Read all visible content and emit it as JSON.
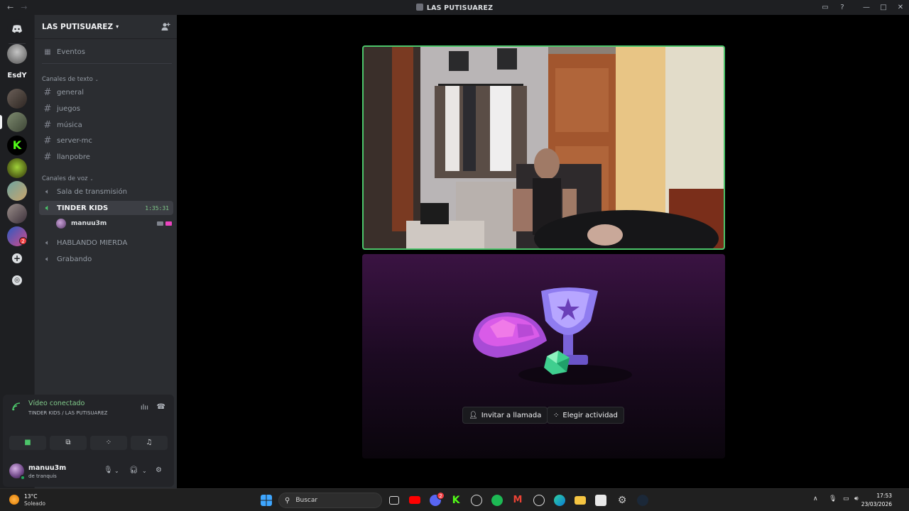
{
  "window": {
    "title": "LAS PUTISUAREZ",
    "back": "←",
    "forward": "→"
  },
  "rail": {
    "folder_label": "EsdY",
    "badge_count": "2"
  },
  "guild": {
    "name": "LAS PUTISUAREZ",
    "events": "Eventos",
    "text_category": "Canales de texto",
    "text_channels": [
      "general",
      "juegos",
      "música",
      "server-mc",
      "llanpobre"
    ],
    "voice_category": "Canales de voz",
    "voice_channels": [
      "Sala de transmisión",
      "TINDER KIDS",
      "HABLANDO MIERDA",
      "Grabando"
    ],
    "call_timer": "1:35:31",
    "voice_user": "manuu3m"
  },
  "voice_panel": {
    "status": "Vídeo conectado",
    "location": "TINDER KIDS / LAS PUTISUAREZ"
  },
  "user": {
    "name": "manuu3m",
    "status": "de tranquis"
  },
  "activity": {
    "invite_label": "Invitar a llamada",
    "activity_label": "Elegir actividad"
  },
  "taskbar": {
    "weather_temp": "13°C",
    "weather_desc": "Soleado",
    "search_placeholder": "Buscar",
    "discord_badge": "2",
    "time": "17:53",
    "date": "23/03/2026"
  },
  "colors": {
    "accent_green": "#4cc56a",
    "sidebar_bg": "#2b2d31",
    "rail_bg": "#1e1f22"
  }
}
